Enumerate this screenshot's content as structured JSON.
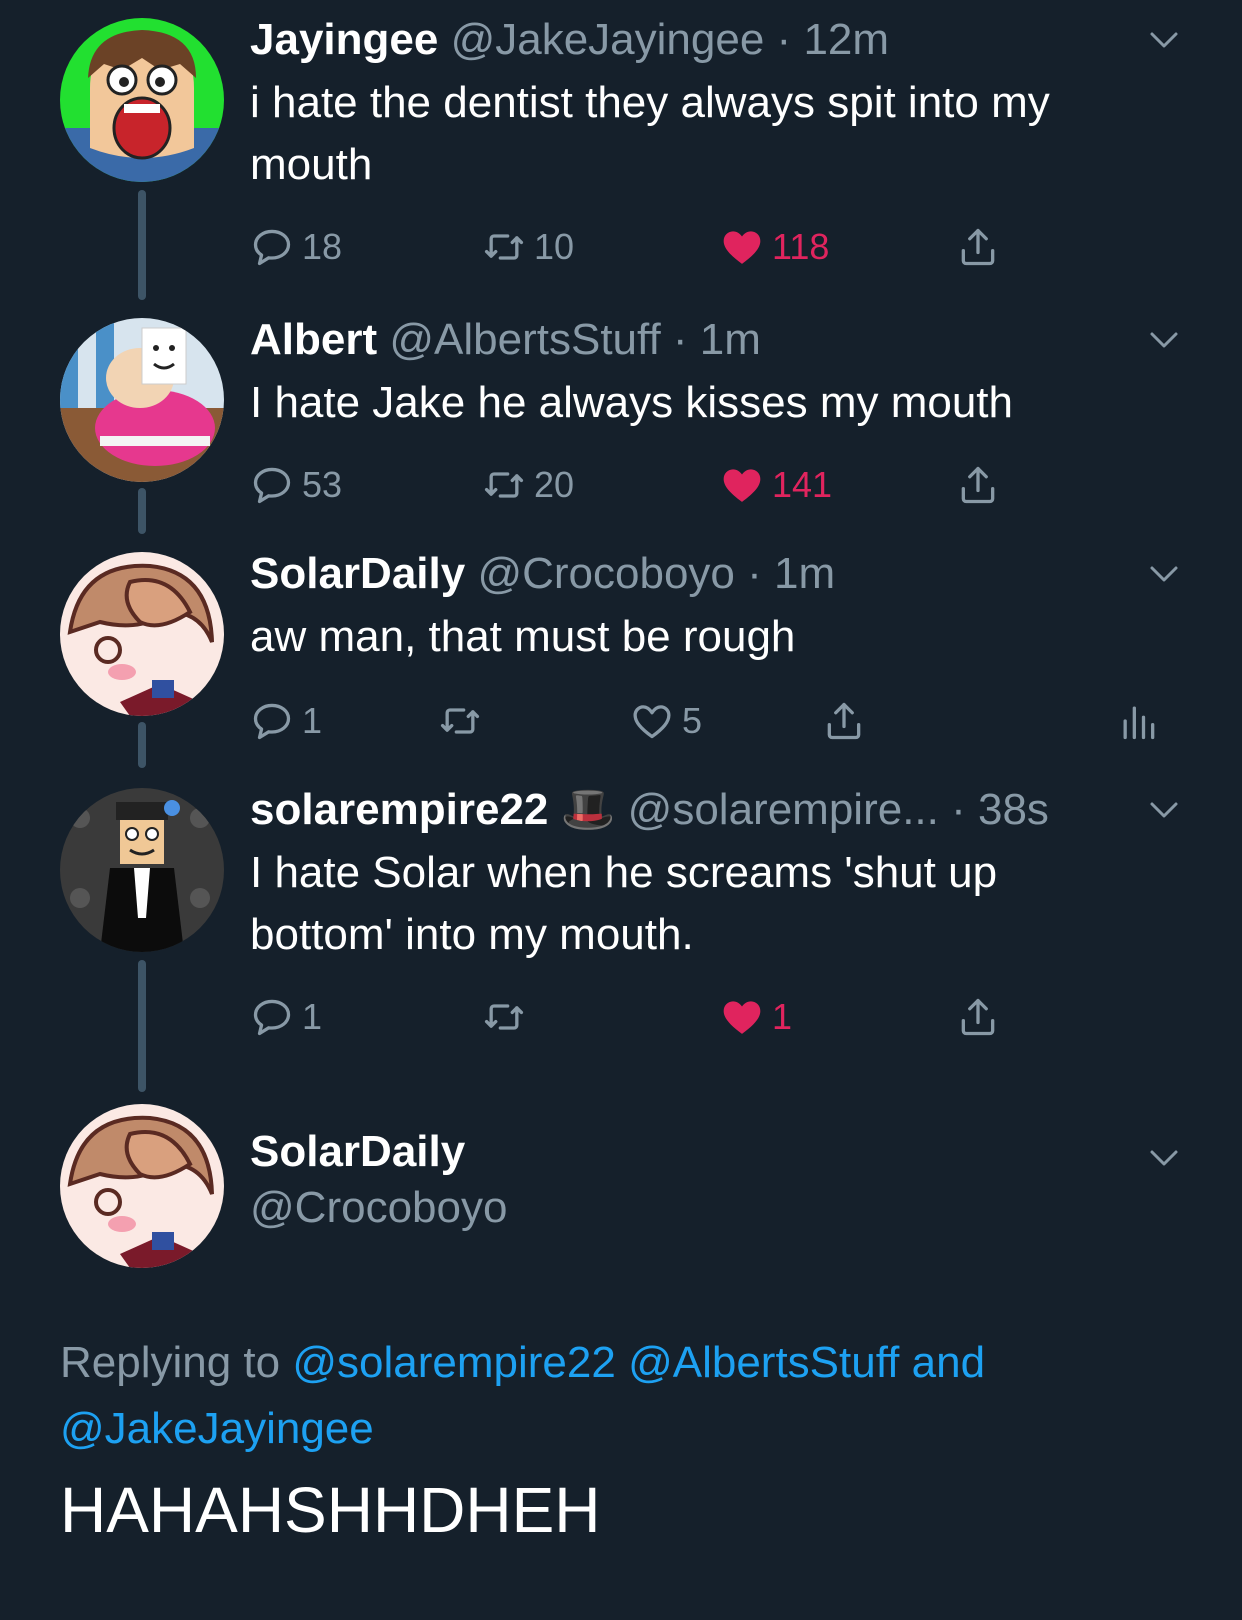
{
  "tweets": [
    {
      "name": "Jayingee",
      "handle": "@JakeJayingee",
      "time": "12m",
      "text": "i hate the dentist they always spit into my mouth",
      "replies": "18",
      "retweets": "10",
      "likes": "118",
      "liked": true
    },
    {
      "name": "Albert",
      "handle": "@AlbertsStuff",
      "time": "1m",
      "text": "I hate Jake he always kisses my mouth",
      "replies": "53",
      "retweets": "20",
      "likes": "141",
      "liked": true
    },
    {
      "name": "SolarDaily",
      "handle": "@Crocoboyo",
      "time": "1m",
      "text": "aw man, that must be rough",
      "replies": "1",
      "retweets": "",
      "likes": "5",
      "liked": false
    },
    {
      "name": "solarempire22",
      "badge": "🎩",
      "handle": "@solarempire...",
      "time": "38s",
      "text": "I hate Solar when he screams 'shut up bottom' into my mouth.",
      "replies": "1",
      "retweets": "",
      "likes": "1",
      "liked": true
    }
  ],
  "focused": {
    "name": "SolarDaily",
    "handle": "@Crocoboyo",
    "replying_label": "Replying to",
    "mention1": "@solarempire22",
    "mention2": "@AlbertsStuff",
    "and_word": "and",
    "mention3": "@JakeJayingee",
    "text": "HAHAHSHHDHEH"
  },
  "colors": {
    "background": "#15202b",
    "secondary_text": "#8899a6",
    "like": "#e0245e",
    "link": "#1da1f2"
  },
  "icons": [
    "reply-icon",
    "retweet-icon",
    "heart-icon",
    "share-icon",
    "analytics-icon",
    "chevron-down-icon"
  ]
}
